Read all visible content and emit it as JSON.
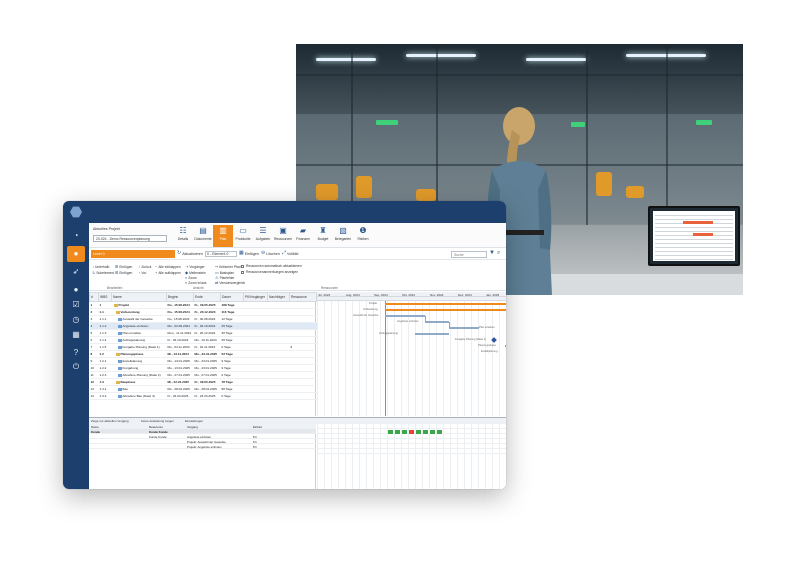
{
  "app": {
    "sidebar_icons": [
      "dashboard-icon",
      "home-icon",
      "rocket-icon",
      "user-avatar-icon",
      "checklist-icon",
      "stopwatch-icon",
      "calendar-icon",
      "help-icon",
      "power-icon"
    ],
    "project_label": "Aktuelles Projekt",
    "project_value": "20-024 - Demo Ressourcenplanung",
    "ribbon": [
      "Details",
      "Dokumente",
      "Plan",
      "Protokolle",
      "Aufgaben",
      "Ressourcen",
      "Finanzen",
      "Budget",
      "Belegarten",
      "Risiken"
    ],
    "ribbon_active": "Plan",
    "search_value": "Level 0",
    "toolbar": {
      "refresh": "Aktualisieren",
      "level": "0 - Element 0",
      "insert": "Einfügen",
      "delete": "Löschen",
      "link": "Vollbild",
      "quick_search": "Suche"
    },
    "options": {
      "left": [
        "Unterhalb",
        "Einfügen",
        "Subelement",
        "Einfügen"
      ],
      "mid": [
        "Zurück",
        "Vor",
        "Alle einklappen",
        "Alle aufklappen"
      ],
      "right": [
        "Vorgänger",
        "Meilenstein",
        "Zoom",
        "Zoom in/aus",
        "Kritischer Pfad",
        "Basisplan",
        "Planfehler",
        "Versionsvergleich"
      ],
      "checks": [
        "Ressourcen automatisch aktualisieren",
        "Ressourcenanmerkungen anzeigen"
      ],
      "sections": [
        "Bearbeiten",
        "Ansicht",
        "Ressourcen"
      ]
    },
    "columns": [
      "#",
      "WBS",
      "Name",
      "Beginn",
      "Ende",
      "Dauer",
      "Pfl/Vorgänger",
      "Nachfolger",
      "Ressource"
    ],
    "rows": [
      [
        "1",
        "1",
        "Projekt",
        "Do., 15.08.2024",
        "Fr., 09.05.2025",
        "188 Tage",
        "",
        "",
        "",
        true
      ],
      [
        "2",
        "1.1",
        "Vorbereitung",
        "Do., 15.08.2024",
        "Fr., 20.12.2024",
        "116 Tage",
        "",
        "",
        "",
        true
      ],
      [
        "3",
        "1.1.1",
        "Auswahl der Gewerke",
        "Do., 15.08.2024",
        "Fr., 30.08.2024",
        "12 Tage",
        "",
        "",
        "",
        false
      ],
      [
        "4",
        "1.1.2",
        "Angebote einholen",
        "Mo., 02.09.2024",
        "Fr., 04.10.2024",
        "25 Tage",
        "",
        "",
        "",
        false
      ],
      [
        "5",
        "1.1.3",
        "Plan erstellen",
        "Mon., 11.11.2024",
        "Fr., 20.12.2024",
        "30 Tage",
        "",
        "",
        "",
        false
      ],
      [
        "6",
        "1.1.4",
        "Auftragsplanung",
        "Fr., 04.10.2024",
        "Mo., 10.11.2024",
        "25 Tage",
        "",
        "",
        "",
        false
      ],
      [
        "7",
        "1.1.5",
        "Freigabe Planung (Datei 1)",
        "Mo., 04.11.2024",
        "Fr., 01.11.2024",
        "0 Tage",
        "",
        "",
        "6",
        false
      ],
      [
        "8",
        "1.2",
        "Planungsphase",
        "Mi., 13.11.2024",
        "Mo., 23.01.2025",
        "53 Tage",
        "",
        "",
        "",
        true
      ],
      [
        "9",
        "1.2.1",
        "Erstellplanung",
        "Mo., 13.01.2025",
        "Mo., 23.01.2025",
        "9 Tage",
        "",
        "",
        "",
        false
      ],
      [
        "10",
        "1.2.2",
        "Freigabung",
        "Mo., 13.01.2025",
        "Mo., 23.01.2025",
        "9 Tage",
        "",
        "",
        "",
        false
      ],
      [
        "11",
        "1.2.3",
        "Abnahme Planung (Datei 2)",
        "Mo., 27.01.2025",
        "Mo., 27.01.2025",
        "0 Tage",
        "",
        "",
        "",
        false
      ],
      [
        "12",
        "1.3",
        "Bauphase",
        "Mi., 22.01.2025",
        "Fr., 09.05.2025",
        "78 Tage",
        "",
        "",
        "",
        true
      ],
      [
        "13",
        "1.3.1",
        "Bau",
        "Mo., 28.04.2025",
        "Mo., 28.04.2025",
        "58 Tage",
        "",
        "",
        "",
        false
      ],
      [
        "14",
        "1.3.2",
        "Abnahme Bau (Datei 3)",
        "Fr., 23.04.2025",
        "Fr., 23.04.2025",
        "0 Tage",
        "",
        "",
        "",
        false
      ]
    ],
    "months": [
      "Jul. 2024",
      "Aug. 2024",
      "Sep. 2024",
      "Okt. 2024",
      "Nov. 2024",
      "Dez. 2024",
      "Jan. 2025"
    ],
    "gantt_labels": [
      "Projekt",
      "Vorbereitung",
      "Auswahl der Gewerke",
      "Angebote einholen",
      "Plan erstellen",
      "Auftragsplanung",
      "Freigabe Planung (Datei 1)",
      "Planungsphase",
      "Erstellplanung"
    ],
    "bottom": {
      "toolbar": [
        "Zeige nur aktuellen Vorgang",
        "Keine Auslastung zeigen",
        "Einstellungen"
      ],
      "headers": [
        "Name",
        "Ressource",
        "Vorgang",
        "Einheit"
      ],
      "rows": [
        [
          "Kunde",
          "Kunde Kunde",
          "",
          "",
          true
        ],
        [
          "",
          "Kunde Kunde",
          "Angebote einholen",
          "8 h",
          false
        ],
        [
          "",
          "",
          "Projekt: Auswahl der Gewerke",
          "8 h",
          false
        ],
        [
          "",
          "",
          "Projekt: Angebote einholen",
          "8 h",
          false
        ]
      ]
    }
  }
}
